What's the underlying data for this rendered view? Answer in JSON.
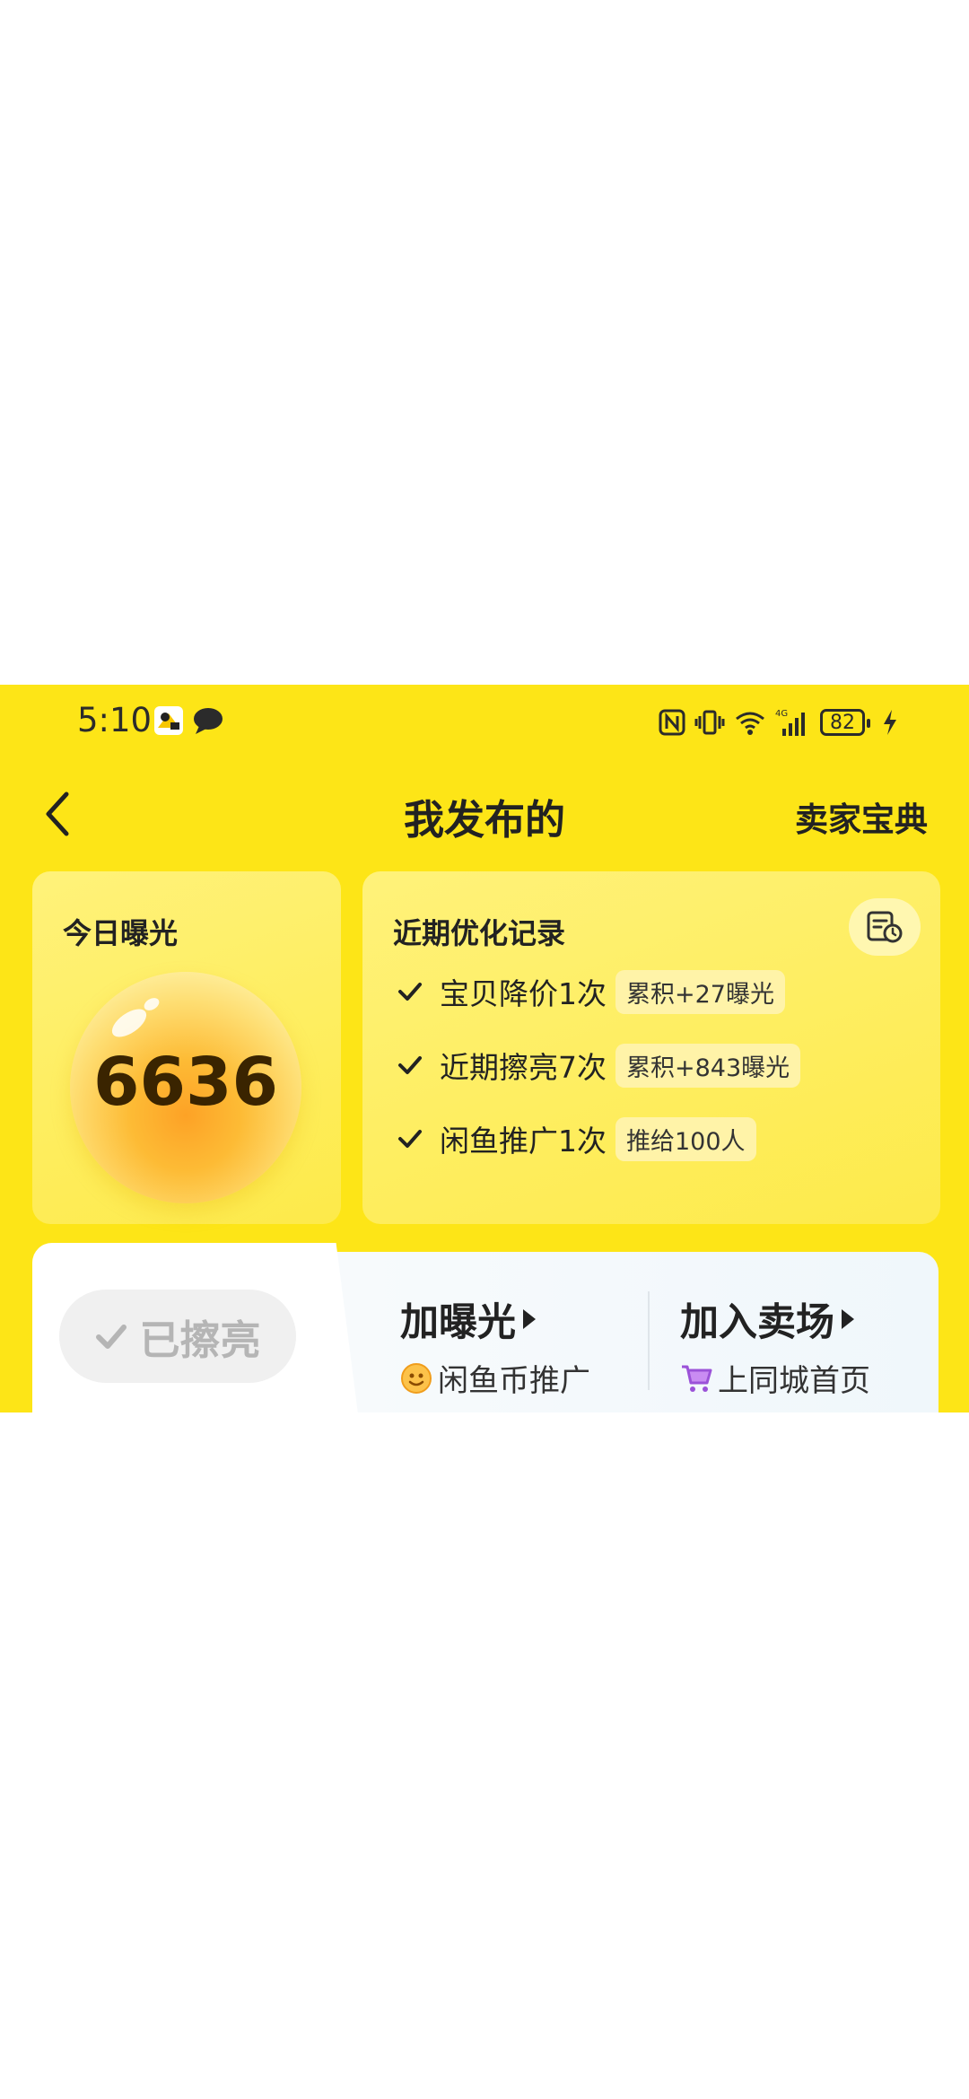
{
  "status_bar": {
    "time": "5:10",
    "battery": "82"
  },
  "nav": {
    "title": "我发布的",
    "right_link": "卖家宝典"
  },
  "exposure_card": {
    "heading": "今日曝光",
    "value": "6636"
  },
  "records_card": {
    "heading": "近期优化记录",
    "items": [
      {
        "text": "宝贝降价1次",
        "tag": "累积+27曝光"
      },
      {
        "text": "近期擦亮7次",
        "tag": "累积+843曝光"
      },
      {
        "text": "闲鱼推广1次",
        "tag": "推给100人"
      }
    ]
  },
  "actions": {
    "polished_label": "已擦亮",
    "boost": {
      "title": "加曝光",
      "subtitle": "闲鱼币推广"
    },
    "market": {
      "title": "加入卖场",
      "subtitle": "上同城首页"
    }
  },
  "colors": {
    "background": "#fde517",
    "accent_orb": "#fda226"
  }
}
